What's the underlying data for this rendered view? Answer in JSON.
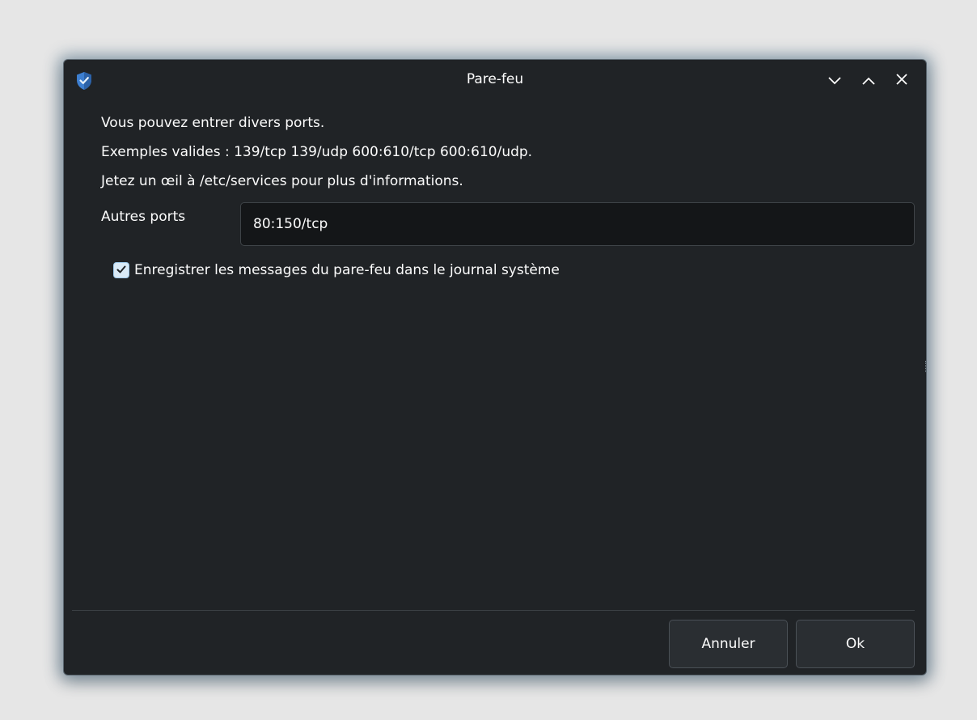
{
  "window": {
    "title": "Pare-feu",
    "icon": "shield-check-icon",
    "controls": {
      "minimize": "chevron-down-icon",
      "maximize": "chevron-up-icon",
      "close": "close-icon"
    }
  },
  "info": {
    "line1": "Vous pouvez entrer divers ports.",
    "line2": "Exemples valides : 139/tcp 139/udp 600:610/tcp 600:610/udp.",
    "line3": "Jetez un œil à /etc/services pour plus d'informations."
  },
  "ports": {
    "label": "Autres ports",
    "value": "80:150/tcp"
  },
  "logging": {
    "label": "Enregistrer les messages du pare-feu dans le journal système",
    "checked": true
  },
  "buttons": {
    "cancel": "Annuler",
    "ok": "Ok"
  },
  "colors": {
    "window_bg": "#202326",
    "accent": "#3daee9",
    "text": "#fcfcfc"
  }
}
